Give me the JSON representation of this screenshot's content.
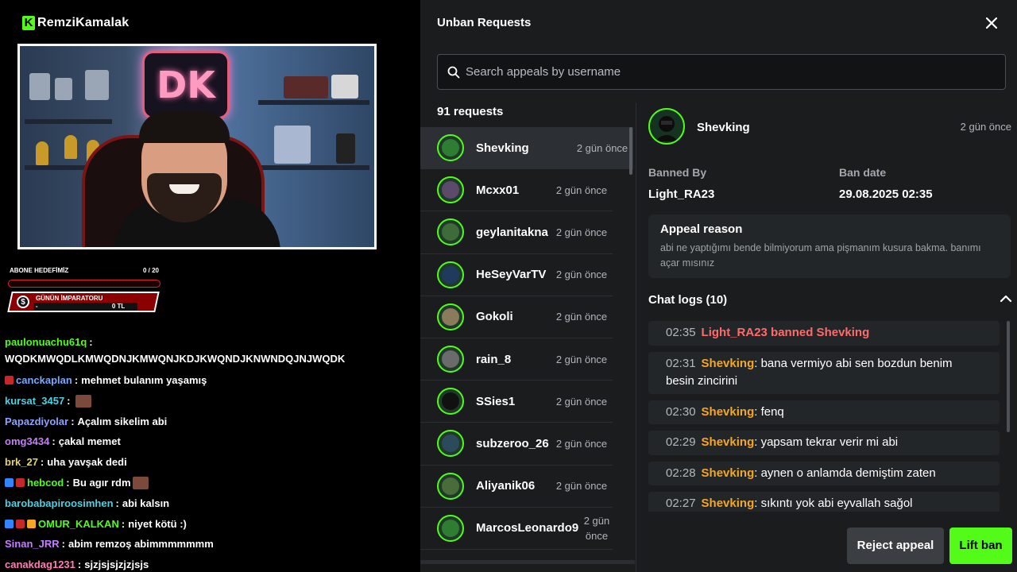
{
  "stream": {
    "brand_logo": "K",
    "brand_name": "RemziKamalak",
    "webcam_sign": "DK",
    "goal_title": "ABONE HEDEFİMİZ",
    "goal_count": "0 / 20",
    "goal_progress": 0,
    "emperor_coin": "$",
    "emperor_title": "GÜNÜN İMPARATORU",
    "emperor_name": "-",
    "emperor_amount": "0 TL",
    "chat": [
      {
        "user": "paulonuachu61q",
        "color": "#53fc18",
        "msg": "WQDKMWQDLKMWQDNJKMWQNJKDJKWQNDJKNWNDQJNJWQDK",
        "wrap": true
      },
      {
        "user": "canckaplan",
        "color": "#7aa7ff",
        "msg": "mehmet bulanım yaşamış",
        "badges": [
          "#c62828"
        ]
      },
      {
        "user": "kursat_3457",
        "color": "#4dd0e1",
        "msg": "",
        "emote": true
      },
      {
        "user": "Papazdiyolar",
        "color": "#8ea2ff",
        "msg": "Açalım sikelim abi"
      },
      {
        "user": "omg3434",
        "color": "#c77dff",
        "msg": "çakal memet"
      },
      {
        "user": "brk_27",
        "color": "#e6d36a",
        "msg": "uha yavşak dedi"
      },
      {
        "user": "hebcod",
        "color": "#53fc18",
        "msg": "Bu agır rdm",
        "badges": [
          "#2f86ff",
          "#c62828"
        ],
        "emote": true
      },
      {
        "user": "barobabapiroosimhen",
        "color": "#4dd0e1",
        "msg": "abi kalsın"
      },
      {
        "user": "OMUR_KALKAN",
        "color": "#53fc18",
        "msg": "niyet kötü :)",
        "badges": [
          "#2f86ff",
          "#c62828",
          "#f5a623"
        ]
      },
      {
        "user": "Sinan_JRR",
        "color": "#c77dff",
        "msg": "abim remzoş abimmmmmmm"
      },
      {
        "user": "canakdag1231",
        "color": "#ff7eb6",
        "msg": "sjzjsjsjzjzjsjs"
      }
    ]
  },
  "panel": {
    "title": "Unban Requests",
    "close_icon": "close-icon",
    "search_placeholder": "Search appeals by username",
    "request_count": "91 requests",
    "requests": [
      {
        "name": "Shevking",
        "time": "2 gün önce",
        "active": true,
        "avatar_color": "#2e7d32"
      },
      {
        "name": "Mcxx01",
        "time": "2 gün önce",
        "avatar_color": "#5d4a6b"
      },
      {
        "name": "geylanitakna",
        "time": "2 gün önce",
        "avatar_color": "#3f6b3a"
      },
      {
        "name": "HeSeyVarTV",
        "time": "2 gün önce",
        "avatar_color": "#1e3a5c"
      },
      {
        "name": "Gokoli",
        "time": "2 gün önce",
        "avatar_color": "#8a7b5c"
      },
      {
        "name": "rain_8",
        "time": "2 gün önce",
        "avatar_color": "#6b6b6b"
      },
      {
        "name": "SSies1",
        "time": "2 gün önce",
        "avatar_color": "#111111"
      },
      {
        "name": "subzeroo_26",
        "time": "2 gün önce",
        "avatar_color": "#2b4a5c"
      },
      {
        "name": "Aliyanik06",
        "time": "2 gün önce",
        "avatar_color": "#4a6b3a"
      },
      {
        "name": "MarcosLeonardo9",
        "time": "2 gün önce",
        "avatar_color": "#2e7d32"
      }
    ],
    "detail": {
      "username": "Shevking",
      "time": "2 gün önce",
      "banned_by_label": "Banned By",
      "banned_by": "Light_RA23",
      "ban_date_label": "Ban date",
      "ban_date": "29.08.2025 02:35",
      "appeal_reason_label": "Appeal reason",
      "appeal_reason": "abi ne yaptığımı bende bilmiyorum ama pişmanım kusura bakma. banımı açar mısınız",
      "chat_logs_label": "Chat logs (10)",
      "logs": [
        {
          "time": "02:35",
          "user": "",
          "text": "Light_RA23 banned Shevking",
          "ban": true
        },
        {
          "time": "02:31",
          "user": "Shevking",
          "text": ": bana vermiyo abi sen bozdun benim besin zincirini"
        },
        {
          "time": "02:30",
          "user": "Shevking",
          "text": ": fenq"
        },
        {
          "time": "02:29",
          "user": "Shevking",
          "text": ": yapsam tekrar verir mi abi"
        },
        {
          "time": "02:28",
          "user": "Shevking",
          "text": ": aynen o anlamda demiştim zaten"
        },
        {
          "time": "02:27",
          "user": "Shevking",
          "text": ": sıkıntı yok abi eyvallah sağol"
        }
      ]
    },
    "reject_label": "Reject appeal",
    "lift_label": "Lift ban",
    "accent_color": "#53fc18",
    "username_color": "#f5a623",
    "ban_color": "#ff6b6b"
  }
}
